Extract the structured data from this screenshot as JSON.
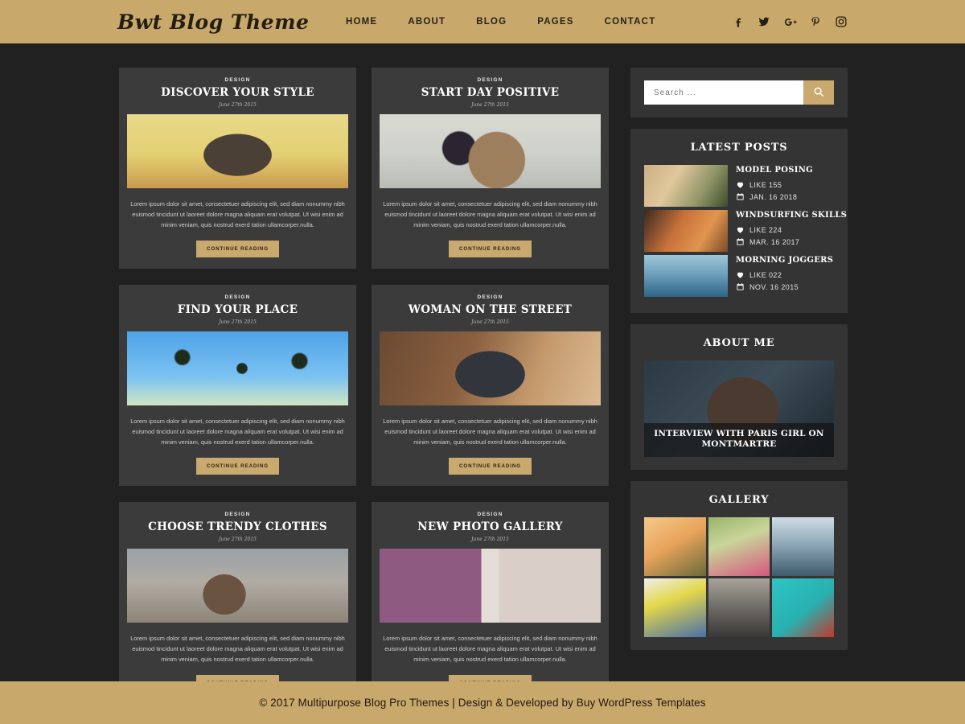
{
  "header": {
    "logo": "Bwt Blog Theme",
    "nav": [
      {
        "label": "HOME"
      },
      {
        "label": "ABOUT"
      },
      {
        "label": "BLOG"
      },
      {
        "label": "PAGES"
      },
      {
        "label": "CONTACT"
      }
    ],
    "social": [
      "facebook-icon",
      "twitter-icon",
      "google-plus-icon",
      "pinterest-icon",
      "instagram-icon"
    ],
    "colors": {
      "background": "#c8a86b",
      "text": "#241d12"
    }
  },
  "colors": {
    "page_background": "#212121",
    "card_background": "#3b3b3b",
    "widget_background": "#343434",
    "accent": "#c9a96e",
    "footer_background": "#c8a86b"
  },
  "posts": [
    {
      "category": "DESIGN",
      "title": "DISCOVER YOUR STYLE",
      "date": "June 27th 2015",
      "excerpt": "Lorem ipsum dolor sit amet, consectetuer adipiscing elit, sed diam nonummy nibh euismod tincidunt ut laoreet dolore magna aliquam erat volutpat. Ut wisi enim ad minim veniam, quis nostrud exerd tation ullamcorper.nulla.",
      "button": "CONTINUE READING",
      "image": "woman-in-front-of-yellow-wooden-gate"
    },
    {
      "category": "DESIGN",
      "title": "START DAY POSITIVE",
      "date": "June 27th 2015",
      "excerpt": "Lorem ipsum dolor sit amet, consectetuer adipiscing elit, sed diam nonummy nibh euismod tincidunt ut laoreet dolore magna aliquam erat volutpat. Ut wisi enim ad minim veniam, quis nostrud exerd tation ullamcorper.nulla.",
      "button": "CONTINUE READING",
      "image": "woman-with-teddy-bear-on-bed"
    },
    {
      "category": "DESIGN",
      "title": "FIND YOUR PLACE",
      "date": "June 27th 2015",
      "excerpt": "Lorem ipsum dolor sit amet, consectetuer adipiscing elit, sed diam nonummy nibh euismod tincidunt ut laoreet dolore magna aliquam erat volutpat. Ut wisi enim ad minim veniam, quis nostrud exerd tation ullamcorper.nulla.",
      "button": "CONTINUE READING",
      "image": "skydivers-with-smoke-trails"
    },
    {
      "category": "DESIGN",
      "title": "WOMAN ON THE STREET",
      "date": "June 27th 2015",
      "excerpt": "Lorem ipsum dolor sit amet, consectetuer adipiscing elit, sed diam nonummy nibh euismod tincidunt ut laoreet dolore magna aliquam erat volutpat. Ut wisi enim ad minim veniam, quis nostrud exerd tation ullamcorper.nulla.",
      "button": "CONTINUE READING",
      "image": "woman-wearing-headphones"
    },
    {
      "category": "DESIGN",
      "title": "CHOOSE TRENDY CLOTHES",
      "date": "June 27th 2015",
      "excerpt": "Lorem ipsum dolor sit amet, consectetuer adipiscing elit, sed diam nonummy nibh euismod tincidunt ut laoreet dolore magna aliquam erat volutpat. Ut wisi enim ad minim veniam, quis nostrud exerd tation ullamcorper.nulla.",
      "button": "CONTINUE READING",
      "image": "woman-shopping-on-street"
    },
    {
      "category": "DESIGN",
      "title": "NEW PHOTO GALLERY",
      "date": "June 27th 2015",
      "excerpt": "Lorem ipsum dolor sit amet, consectetuer adipiscing elit, sed diam nonummy nibh euismod tincidunt ut laoreet dolore magna aliquam erat volutpat. Ut wisi enim ad minim veniam, quis nostrud exerd tation ullamcorper.nulla.",
      "button": "CONTINUE READING",
      "image": "two-women-with-hats-over-eyes"
    }
  ],
  "sidebar": {
    "search": {
      "placeholder": "Search ...",
      "value": "",
      "button_icon": "search-icon"
    },
    "latest_posts": {
      "title": "LATEST POSTS",
      "items": [
        {
          "name": "MODEL POSING",
          "likes": "LIKE 155",
          "date": "JAN. 16 2018",
          "image": "model-in-field"
        },
        {
          "name": "WINDSURFING SKILLS",
          "likes": "LIKE 224",
          "date": "MAR. 16 2017",
          "image": "photographer-in-autumn-forest"
        },
        {
          "name": "MORNING JOGGERS",
          "likes": "LIKE 022",
          "date": "NOV. 16 2015",
          "image": "woman-by-the-sea"
        }
      ]
    },
    "about_me": {
      "title": "ABOUT ME",
      "caption": "INTERVIEW WITH PARIS GIRL ON MONTMARTRE",
      "image": "smiling-woman-portrait"
    },
    "gallery": {
      "title": "GALLERY",
      "items": [
        {
          "image": "woman-walking-in-golden-field"
        },
        {
          "image": "woman-in-pink-hat-with-flowers"
        },
        {
          "image": "woman-by-the-lake"
        },
        {
          "image": "woman-sitting-in-yellow-shirt"
        },
        {
          "image": "two-people-standing-on-pier"
        },
        {
          "image": "man-in-red-sweater-by-teal-wall"
        }
      ]
    }
  },
  "footer": {
    "text": "© 2017 Multipurpose Blog Pro Themes | Design & Developed by Buy WordPress Templates"
  }
}
